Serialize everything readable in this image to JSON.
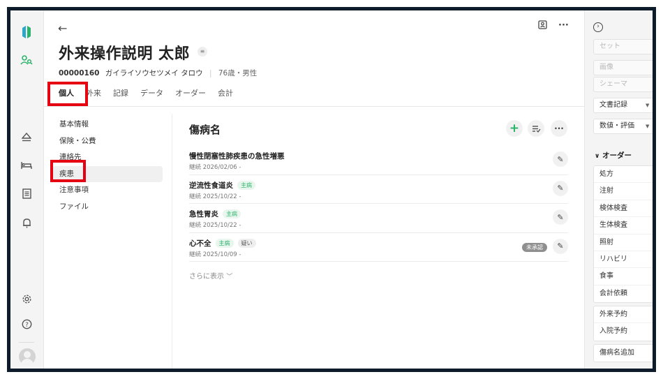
{
  "header": {
    "back_icon": "arrow-left-icon",
    "patient_name": "外来操作説明 太郎",
    "patient_id": "00000160",
    "kana": "ガイライソウセツメイ タロウ",
    "age_sex": "76歳・男性",
    "right_icons": [
      "badge-icon",
      "more-horizontal-icon"
    ]
  },
  "tabs": [
    {
      "label": "個人",
      "active": true
    },
    {
      "label": "外来",
      "active": false
    },
    {
      "label": "記録",
      "active": false
    },
    {
      "label": "データ",
      "active": false
    },
    {
      "label": "オーダー",
      "active": false
    },
    {
      "label": "会計",
      "active": false
    }
  ],
  "sections": [
    {
      "label": "基本情報",
      "active": false
    },
    {
      "label": "保険・公費",
      "active": false
    },
    {
      "label": "連絡先",
      "active": false
    },
    {
      "label": "疾患",
      "active": true
    },
    {
      "label": "注意事項",
      "active": false
    },
    {
      "label": "ファイル",
      "active": false
    }
  ],
  "main": {
    "title": "傷病名",
    "add_label": "+",
    "sort_label": "≡",
    "more_label": "···",
    "show_more": "さらに表示",
    "diseases": [
      {
        "name": "慢性閉塞性肺疾患の急性増悪",
        "main": "",
        "doubt": "",
        "date": "継続 2026/02/06 -",
        "unconfirmed": ""
      },
      {
        "name": "逆流性食道炎",
        "main": "主病",
        "doubt": "",
        "date": "継続 2025/10/22 -",
        "unconfirmed": ""
      },
      {
        "name": "急性胃炎",
        "main": "主病",
        "doubt": "",
        "date": "継続 2025/10/22 -",
        "unconfirmed": ""
      },
      {
        "name": "心不全",
        "main": "主病",
        "doubt": "疑い",
        "date": "継続 2025/10/09 -",
        "unconfirmed": "未承認"
      }
    ]
  },
  "right_panel": {
    "set_label": "セット",
    "image_label": "画像",
    "schema_label": "シェーマ",
    "document_label": "文書記録",
    "numeric_label": "数値・評価",
    "order_header": "オーダー",
    "orders": [
      "処方",
      "注射",
      "検体検査",
      "生体検査",
      "照射",
      "リハビリ",
      "食事",
      "会計依頼"
    ],
    "reservations": [
      "外来予約",
      "入院予約"
    ],
    "add_disease": "傷病名追加"
  },
  "accent_color": "#2bb36b",
  "highlight_color": "#e50012"
}
